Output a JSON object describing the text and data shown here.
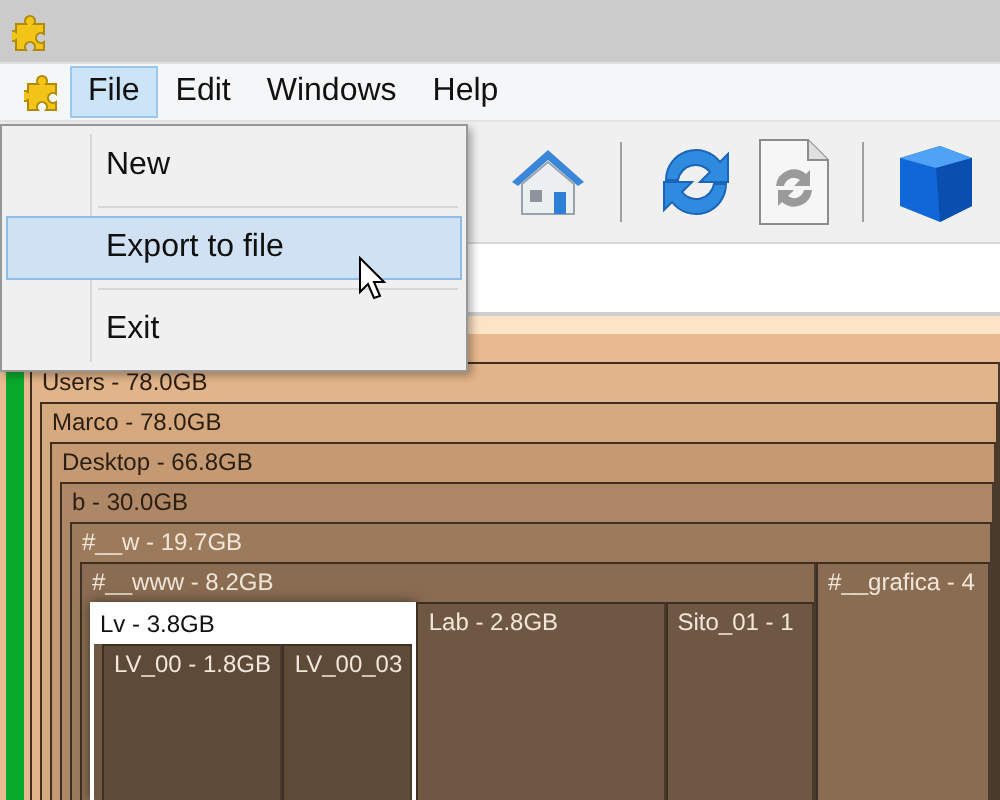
{
  "menu_bar": [
    {
      "label": "File",
      "selected": true
    },
    {
      "label": "Edit",
      "selected": false
    },
    {
      "label": "Windows",
      "selected": false
    },
    {
      "label": "Help",
      "selected": false
    }
  ],
  "file_menu": [
    {
      "kind": "item",
      "label": "New",
      "selected": false
    },
    {
      "kind": "separator"
    },
    {
      "kind": "item",
      "label": "Export to file",
      "selected": true
    },
    {
      "kind": "separator"
    },
    {
      "kind": "item",
      "label": "Exit",
      "selected": false
    }
  ],
  "treemap": {
    "root": {
      "label": "Users - 78.0GB",
      "selected": false,
      "children": [
        {
          "label": "Marco - 78.0GB",
          "selected": false,
          "children": [
            {
              "label": "Desktop - 66.8GB",
              "selected": false,
              "children": [
                {
                  "label": "b - 30.0GB",
                  "selected": false,
                  "children": [
                    {
                      "label": "#__w - 19.7GB",
                      "selected": false,
                      "children": [
                        {
                          "label": "#__www - 8.2GB",
                          "selected": false,
                          "children": [
                            {
                              "label": "Lv - 3.8GB",
                              "selected": true,
                              "children": [
                                {
                                  "label": "LV_00 - 1.8GB",
                                  "selected": false
                                },
                                {
                                  "label": "LV_00_03",
                                  "selected": false
                                }
                              ]
                            },
                            {
                              "label": "Lab - 2.8GB",
                              "selected": false
                            },
                            {
                              "label": "Sito_01 - 1",
                              "selected": false
                            }
                          ]
                        },
                        {
                          "label": "#__grafica - 4",
                          "selected": false
                        }
                      ]
                    }
                  ]
                }
              ]
            }
          ]
        }
      ]
    }
  }
}
